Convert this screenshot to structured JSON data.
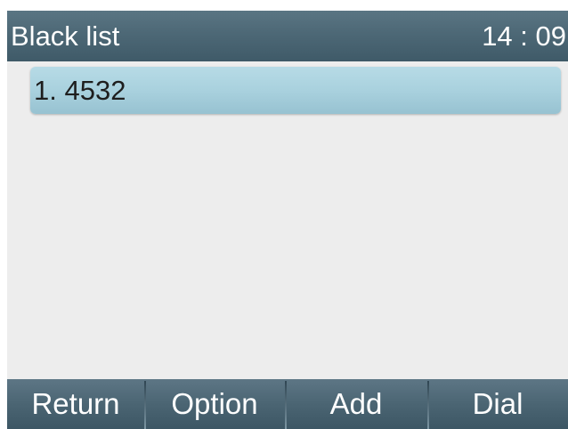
{
  "header": {
    "title": "Black list",
    "clock": "14 : 09"
  },
  "list": {
    "items": [
      {
        "label": "1. 4532"
      }
    ]
  },
  "softkeys": {
    "return_label": "Return",
    "option_label": "Option",
    "add_label": "Add",
    "dial_label": "Dial"
  },
  "colors": {
    "title_bar": "#4d6876",
    "content_bg": "#ededed",
    "selected_item": "#a9d1de",
    "softkey_bar": "#4b6573",
    "text_light": "#ffffff",
    "text_dark": "#1e1e1e"
  }
}
